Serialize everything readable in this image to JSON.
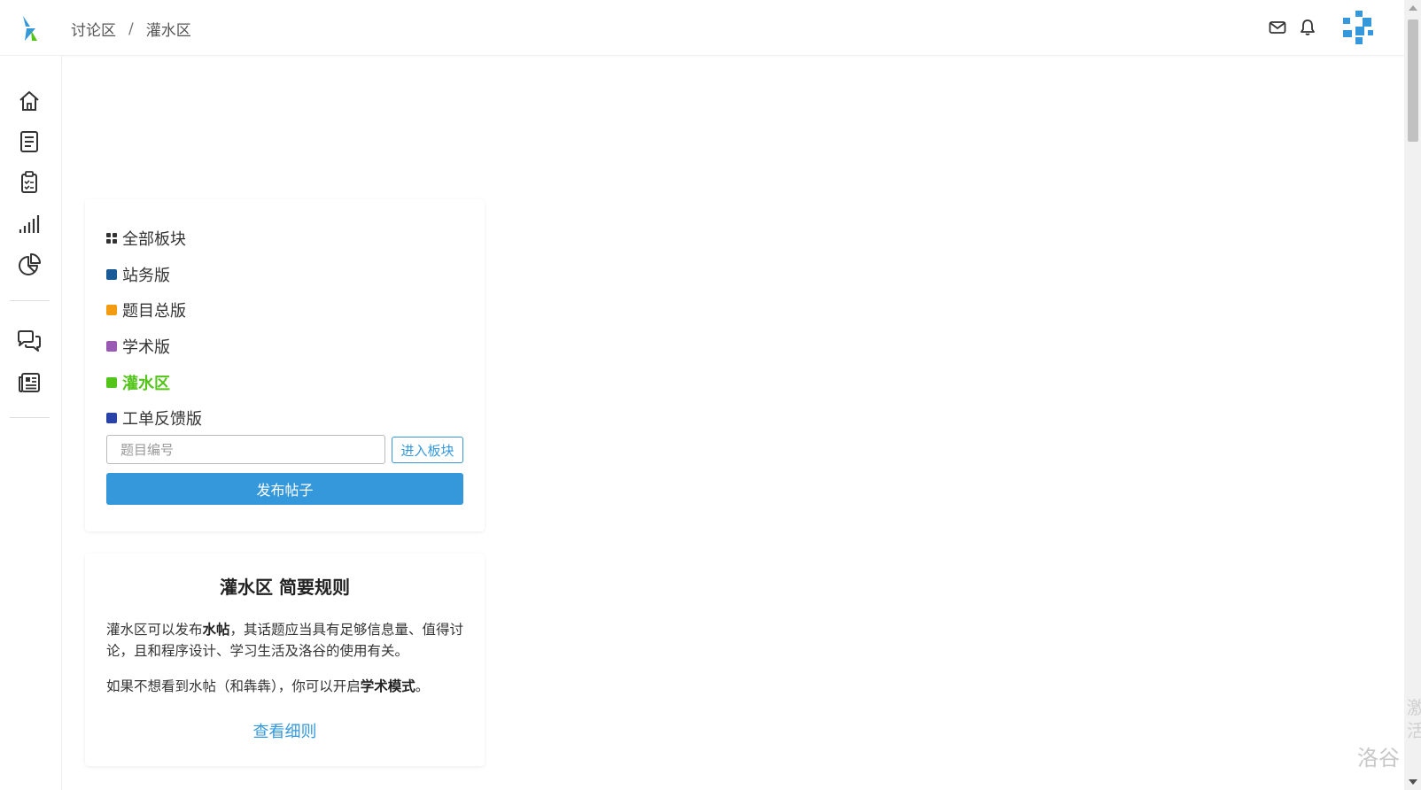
{
  "breadcrumb": {
    "items": [
      "讨论区",
      "灌水区"
    ],
    "separator": "/"
  },
  "forum_list": {
    "items": [
      {
        "label": "全部板块",
        "color": "#333333",
        "icon": "grid-icon",
        "active": false
      },
      {
        "label": "站务版",
        "color": "#1a5a96",
        "active": false
      },
      {
        "label": "题目总版",
        "color": "#f39c11",
        "active": false
      },
      {
        "label": "学术版",
        "color": "#9b59b6",
        "active": false
      },
      {
        "label": "灌水区",
        "color": "#52c41a",
        "active": true
      },
      {
        "label": "工单反馈版",
        "color": "#2842a8",
        "active": false
      }
    ]
  },
  "jump": {
    "placeholder": "题目编号",
    "enter_label": "进入板块"
  },
  "post_button": "发布帖子",
  "rules": {
    "title": "灌水区 简要规则",
    "p1_a": "灌水区可以发布",
    "p1_b": "水帖",
    "p1_c": "，其话题应当具有足够信息量、值得讨论，且和程序设计、学习生活及洛谷的使用有关。",
    "p2_a": "如果不想看到水帖（和犇犇），你可以开启",
    "p2_b": "学术模式",
    "p2_c": "。",
    "link": "查看细则"
  },
  "watermark": "洛谷",
  "edge_text": "激活",
  "colors": {
    "accent": "#3498db",
    "active_green": "#52c41a"
  }
}
